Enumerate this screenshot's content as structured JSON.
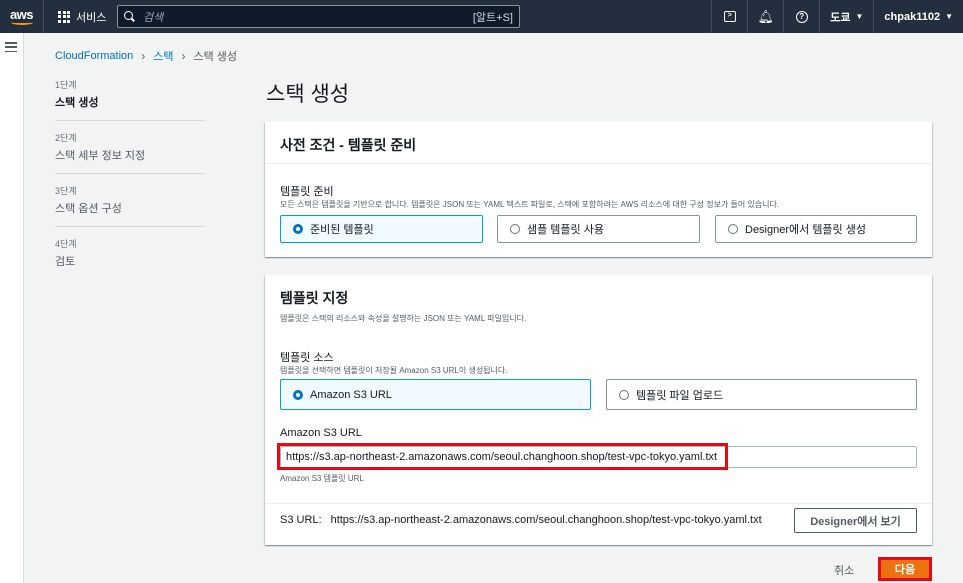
{
  "topnav": {
    "logo": "aws",
    "services_label": "서비스",
    "search_placeholder": "검색",
    "search_shortcut": "[알트+S]",
    "region": "도쿄",
    "account": "chpak1102"
  },
  "breadcrumb": {
    "items": [
      "CloudFormation",
      "스택",
      "스택 생성"
    ]
  },
  "steps": [
    {
      "num": "1단계",
      "name": "스택 생성",
      "active": true
    },
    {
      "num": "2단계",
      "name": "스택 세부 정보 지정",
      "active": false
    },
    {
      "num": "3단계",
      "name": "스택 옵션 구성",
      "active": false
    },
    {
      "num": "4단계",
      "name": "검토",
      "active": false
    }
  ],
  "page_title": "스택 생성",
  "prereq": {
    "title": "사전 조건 - 템플릿 준비",
    "label": "템플릿 준비",
    "description": "모든 스택은 템플릿을 기반으로 합니다. 템플릿은 JSON 또는 YAML 텍스트 파일로, 스택에 포함하려는 AWS 리소스에 대한 구성 정보가 들어 있습니다.",
    "options": [
      "준비된 템플릿",
      "샘플 템플릿 사용",
      "Designer에서 템플릿 생성"
    ],
    "selected": 0
  },
  "template": {
    "title": "템플릿 지정",
    "description": "템플릿은 스택의 리소스와 속성을 설명하는 JSON 또는 YAML 파일입니다.",
    "source_label": "템플릿 소스",
    "source_description": "템플릿을 선택하면 템플릿이 저장될 Amazon S3 URL이 생성됩니다.",
    "source_options": [
      "Amazon S3 URL",
      "템플릿 파일 업로드"
    ],
    "selected": 0,
    "url_label": "Amazon S3 URL",
    "url_value": "https://s3.ap-northeast-2.amazonaws.com/seoul.changhoon.shop/test-vpc-tokyo.yaml.txt",
    "url_hint": "Amazon S3 템플릿 URL",
    "s3url_label": "S3 URL:",
    "s3url_value": "https://s3.ap-northeast-2.amazonaws.com/seoul.changhoon.shop/test-vpc-tokyo.yaml.txt",
    "designer_button": "Designer에서 보기"
  },
  "footer": {
    "cancel": "취소",
    "next": "다음"
  },
  "colors": {
    "nav_bg": "#232f3e",
    "link": "#0073bb",
    "primary": "#ec7211",
    "highlight": "#e50914"
  }
}
